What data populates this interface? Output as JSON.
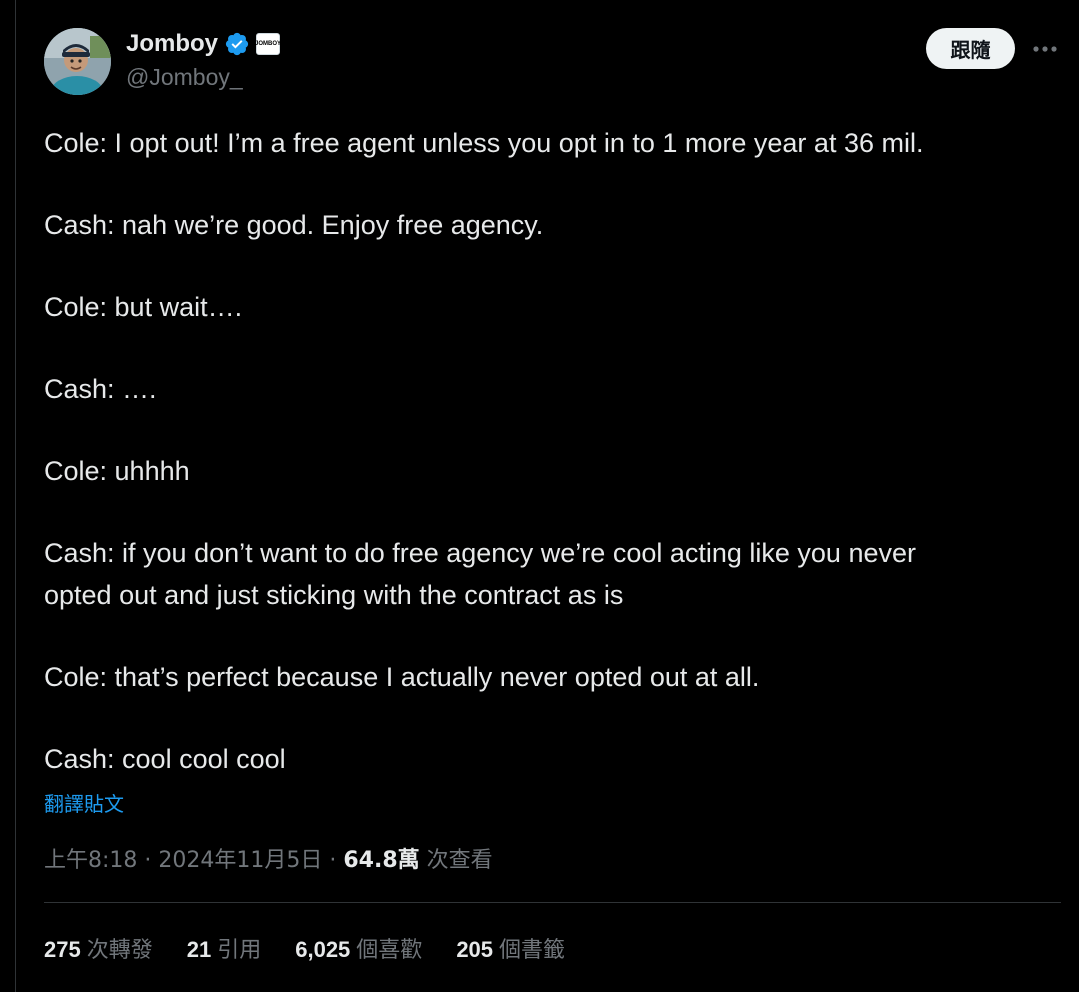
{
  "author": {
    "display_name": "Jomboy",
    "handle": "@Jomboy_",
    "badge_text": "JOMBOY",
    "avatar_icon": "user-photo-avatar",
    "verified_icon": "verified-checkmark-icon"
  },
  "actions": {
    "follow_label": "跟隨",
    "more_icon": "more-horizontal-icon"
  },
  "tweet": {
    "paragraphs": [
      "Cole: I opt out! I’m a free agent unless you opt in to 1 more year at 36 mil.",
      "Cash: nah we’re good. Enjoy free agency.",
      "Cole: but wait….",
      "Cash: ….",
      "Cole: uhhhh",
      "Cash: if you don’t want to do free agency we’re cool acting like you never\nopted out and just sticking with the contract as is",
      "Cole: that’s perfect because I actually never opted out at all.",
      "Cash: cool cool cool"
    ],
    "translate_label": "翻譯貼文"
  },
  "meta": {
    "time": "上午8:18",
    "separator": " · ",
    "date": "2024年11月5日",
    "views_count": "64.8萬",
    "views_label": " 次查看"
  },
  "stats": [
    {
      "count": "275",
      "label": "次轉發"
    },
    {
      "count": "21",
      "label": "引用"
    },
    {
      "count": "6,025",
      "label": "個喜歡"
    },
    {
      "count": "205",
      "label": "個書籤"
    }
  ],
  "colors": {
    "background": "#000000",
    "text_primary": "#e7e9ea",
    "text_secondary": "#71767b",
    "link": "#1d9bf0",
    "verified": "#1d9bf0",
    "divider": "#2f3336"
  }
}
